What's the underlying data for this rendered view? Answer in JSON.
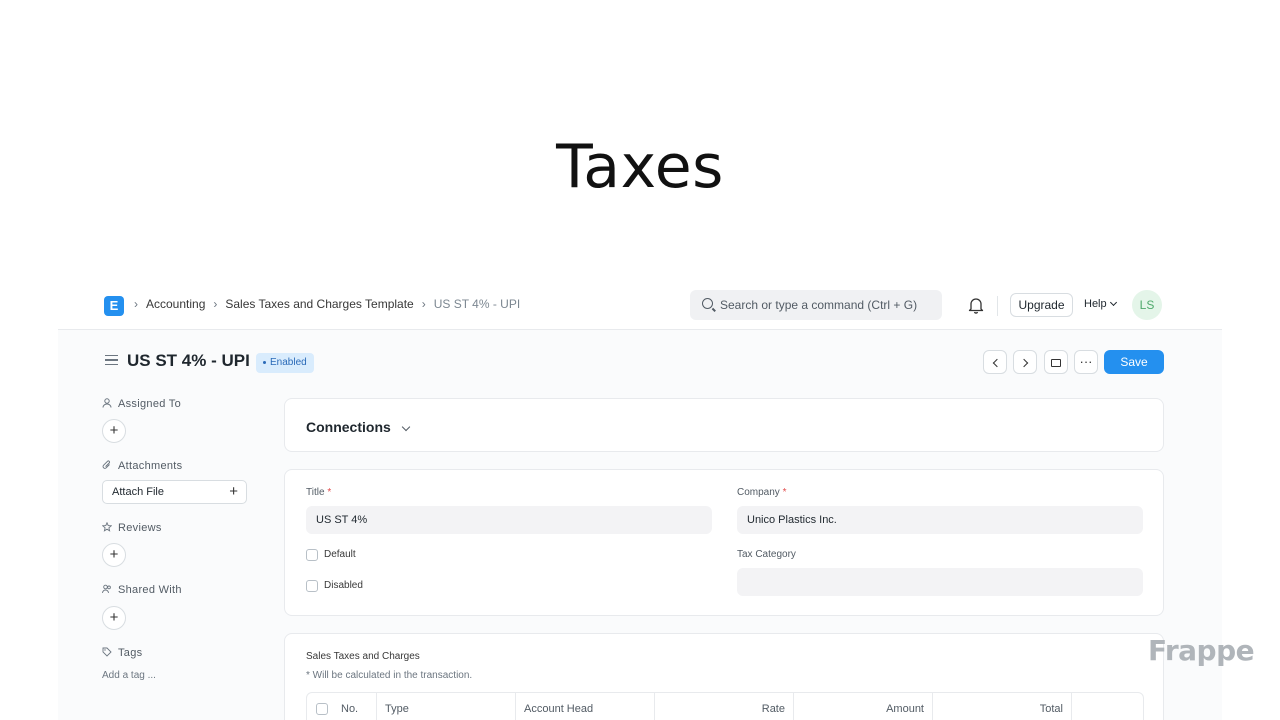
{
  "slide": {
    "title": "Taxes"
  },
  "navbar": {
    "logo_letter": "E",
    "breadcrumbs": [
      "Accounting",
      "Sales Taxes and Charges Template",
      "US ST 4% - UPI"
    ],
    "search_placeholder": "Search or type a command (Ctrl + G)",
    "upgrade_label": "Upgrade",
    "help_label": "Help",
    "avatar_initials": "LS"
  },
  "page": {
    "title": "US ST 4% - UPI",
    "status_badge": "Enabled",
    "more_label": "···",
    "save_label": "Save"
  },
  "sidebar": {
    "assigned_to": "Assigned To",
    "attachments": "Attachments",
    "attach_file": "Attach File",
    "reviews": "Reviews",
    "shared_with": "Shared With",
    "tags": "Tags",
    "add_tag": "Add a tag ..."
  },
  "connections": {
    "title": "Connections"
  },
  "form": {
    "title_label": "Title",
    "title_value": "US ST 4%",
    "company_label": "Company",
    "company_value": "Unico Plastics Inc.",
    "default_label": "Default",
    "disabled_label": "Disabled",
    "tax_category_label": "Tax Category",
    "tax_category_value": ""
  },
  "taxes_section": {
    "label": "Sales Taxes and Charges",
    "note": "* Will be calculated in the transaction.",
    "columns": [
      "No.",
      "Type",
      "Account Head",
      "Rate",
      "Amount",
      "Total"
    ]
  },
  "watermark": "Frappe",
  "colors": {
    "primary": "#2490ef",
    "badge_bg": "#d9ecfd",
    "badge_text": "#2a6ab8",
    "avatar_bg": "#e4f5e9",
    "avatar_text": "#4fa96c"
  }
}
